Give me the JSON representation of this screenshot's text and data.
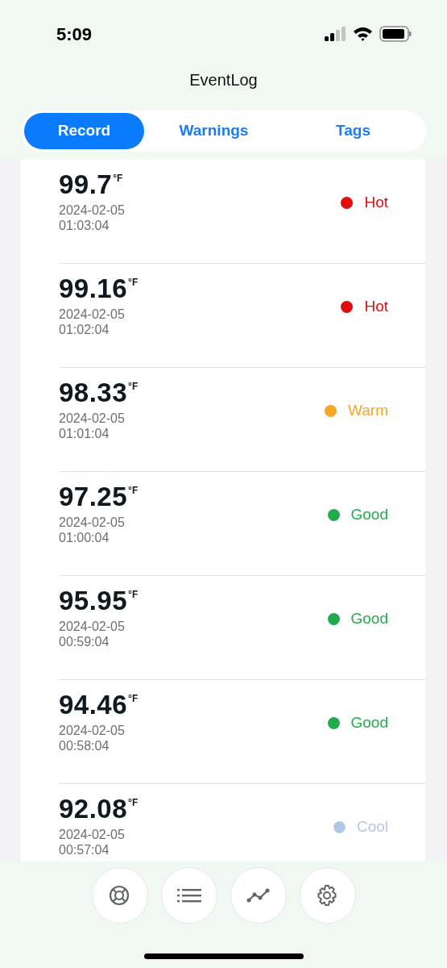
{
  "status_bar": {
    "time": "5:09"
  },
  "header": {
    "title": "EventLog"
  },
  "tabs": [
    {
      "label": "Record",
      "selected": true
    },
    {
      "label": "Warnings",
      "selected": false
    },
    {
      "label": "Tags",
      "selected": false
    }
  ],
  "records": [
    {
      "value": "99.7",
      "unit": "°F",
      "date": "2024-02-05",
      "time": "01:03:04",
      "status": "Hot",
      "color": "#e00e0e"
    },
    {
      "value": "99.16",
      "unit": "°F",
      "date": "2024-02-05",
      "time": "01:02:04",
      "status": "Hot",
      "color": "#e00e0e"
    },
    {
      "value": "98.33",
      "unit": "°F",
      "date": "2024-02-05",
      "time": "01:01:04",
      "status": "Warm",
      "color": "#f5a623"
    },
    {
      "value": "97.25",
      "unit": "°F",
      "date": "2024-02-05",
      "time": "01:00:04",
      "status": "Good",
      "color": "#22aa4f"
    },
    {
      "value": "95.95",
      "unit": "°F",
      "date": "2024-02-05",
      "time": "00:59:04",
      "status": "Good",
      "color": "#22aa4f"
    },
    {
      "value": "94.46",
      "unit": "°F",
      "date": "2024-02-05",
      "time": "00:58:04",
      "status": "Good",
      "color": "#22aa4f"
    },
    {
      "value": "92.08",
      "unit": "°F",
      "date": "2024-02-05",
      "time": "00:57:04",
      "status": "Cool",
      "color": "#b4c8e4"
    }
  ],
  "bottom_bar": [
    {
      "kind": "lifebuoy"
    },
    {
      "kind": "list"
    },
    {
      "kind": "chart"
    },
    {
      "kind": "settings"
    }
  ]
}
